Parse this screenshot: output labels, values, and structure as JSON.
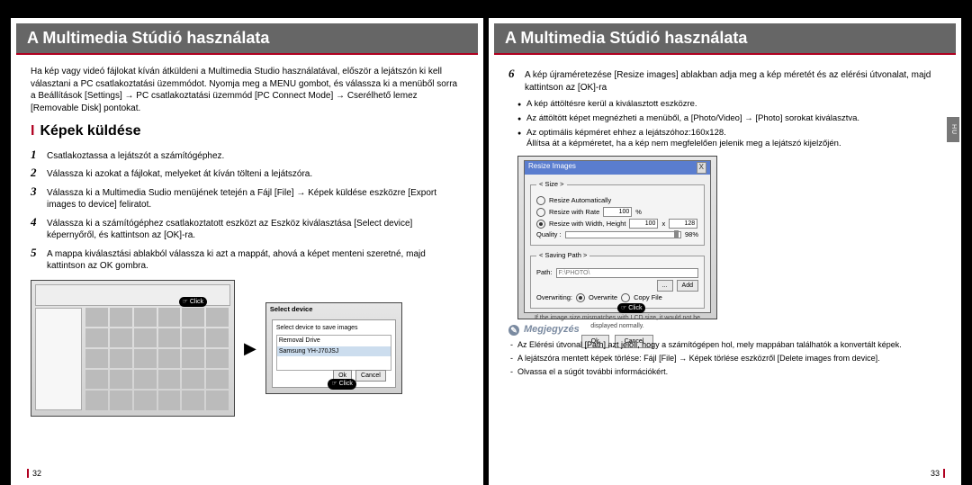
{
  "titles": {
    "left": "A Multimedia Stúdió használata",
    "right": "A Multimedia Stúdió használata"
  },
  "side_tab": "HU",
  "left": {
    "intro": "Ha kép vagy videó fájlokat kíván átküldeni a Multimedia Studio használatával, először a lejátszón ki kell választani a PC csatlakoztatási üzemmódot. Nyomja meg a MENU gombot, és válassza ki a menüből sorra a Beállítások [Settings] → PC csatlakoztatási üzemmód [PC Connect Mode] → Cserélhető lemez [Removable Disk] pontokat.",
    "section_marker": "I",
    "section_heading": "Képek küldése",
    "steps": [
      "Csatlakoztassa a lejátszót a számítógéphez.",
      "Válassza ki azokat a fájlokat, melyeket át kíván tölteni a lejátszóra.",
      "Válassza ki a Multimedia Sudio menüjének tetején a Fájl [File] → Képek küldése eszközre [Export images to device] feliratot.",
      "Válassza ki a számítógéphez csatlakoztatott eszközt az Eszköz kiválasztása [Select device] képernyőről, és kattintson az [OK]-ra.",
      "A mappa kiválasztási ablakból válassza ki azt a mappát, ahová a képet menteni szeretné, majd kattintson az OK gombra."
    ],
    "click_label": "Click",
    "select_device": {
      "title": "Select device",
      "caption": "Select device to save images",
      "item1": "Removal Drive",
      "item2": "Samsung YH-J70JSJ",
      "ok": "Ok",
      "cancel": "Cancel"
    },
    "page_num": "32"
  },
  "right": {
    "step6_num": "6",
    "step6": "A kép újraméretezése [Resize images] ablakban adja meg a kép méretét és az elérési útvonalat, majd kattintson az [OK]-ra",
    "bullets": [
      "A kép áttöltésre kerül a kiválasztott eszközre.",
      "Az áttöltött képet megnézheti a menüből, a [Photo/Video] → [Photo] sorokat kiválasztva.",
      "Az optimális képméret ehhez a lejátszóhoz:160x128.\nÁllítsa át a képméretet, ha a kép nem megfelelően jelenik meg a lejátszó kijelzőjén."
    ],
    "dialog": {
      "title": "Resize Images",
      "close": "X",
      "size_legend": "< Size >",
      "opt_auto": "Resize Automatically",
      "opt_rate": "Resize with Rate",
      "rate_value": "100",
      "rate_unit": "%",
      "opt_wh": "Resize with Width, Height",
      "w": "100",
      "h": "128",
      "quality_label": "Quality :",
      "quality_value": "98%",
      "path_legend": "< Saving Path >",
      "path_label": "Path:",
      "path_value": "F:\\PHOTO\\",
      "btn_sel": "...",
      "btn_add": "Add",
      "overwrite_label": "Overwriting:",
      "ow_overwrite": "Overwrite",
      "ow_copy": "Copy File",
      "msg": "If the image size mismatches with LCD size, it would not be displayed normally.",
      "ok": "Ok",
      "cancel": "Cancel"
    },
    "click_label": "Click",
    "note_heading": "Megjegyzés",
    "notes": [
      "Az Elérési útvonal [Path] azt jelöli, hogy a számítógépen hol, mely mappában találhatók a konvertált képek.",
      "A lejátszóra mentett képek törlése: Fájl [File] → Képek törlése eszközről [Delete images from device].",
      "Olvassa el a súgót további információkért."
    ],
    "page_num": "33"
  },
  "chart_data": null
}
